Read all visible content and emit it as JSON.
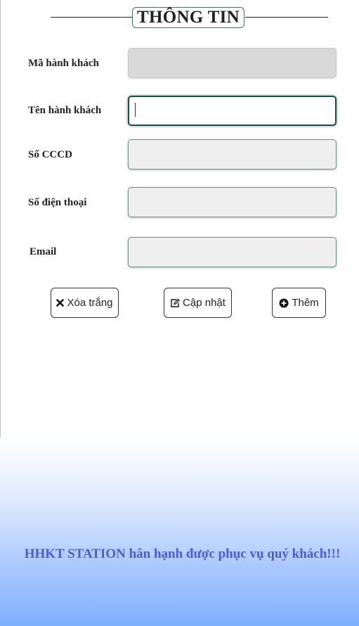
{
  "header": {
    "title": "THÔNG TIN"
  },
  "form": {
    "fields": [
      {
        "label": "Mã hành khách",
        "value": "",
        "placeholder": ""
      },
      {
        "label": "Tên hành khách",
        "value": "",
        "placeholder": ""
      },
      {
        "label": "Số CCCD",
        "value": "",
        "placeholder": ""
      },
      {
        "label": "Số điện thoại",
        "value": "",
        "placeholder": ""
      },
      {
        "label": "Email",
        "value": "",
        "placeholder": ""
      }
    ]
  },
  "buttons": {
    "clear": {
      "label": "Xóa trắng",
      "icon": "times-icon"
    },
    "update": {
      "label": "Cập nhật",
      "icon": "edit-icon"
    },
    "add": {
      "label": "Thêm",
      "icon": "plus-circle-icon"
    }
  },
  "footer": {
    "message": "HHKT STATION hân hạnh được phục vụ quý khách!!!"
  },
  "colors": {
    "accent": "#2e7d6b",
    "footer_text": "#4d5ad6",
    "gradient_end": "#7fb0ff"
  }
}
